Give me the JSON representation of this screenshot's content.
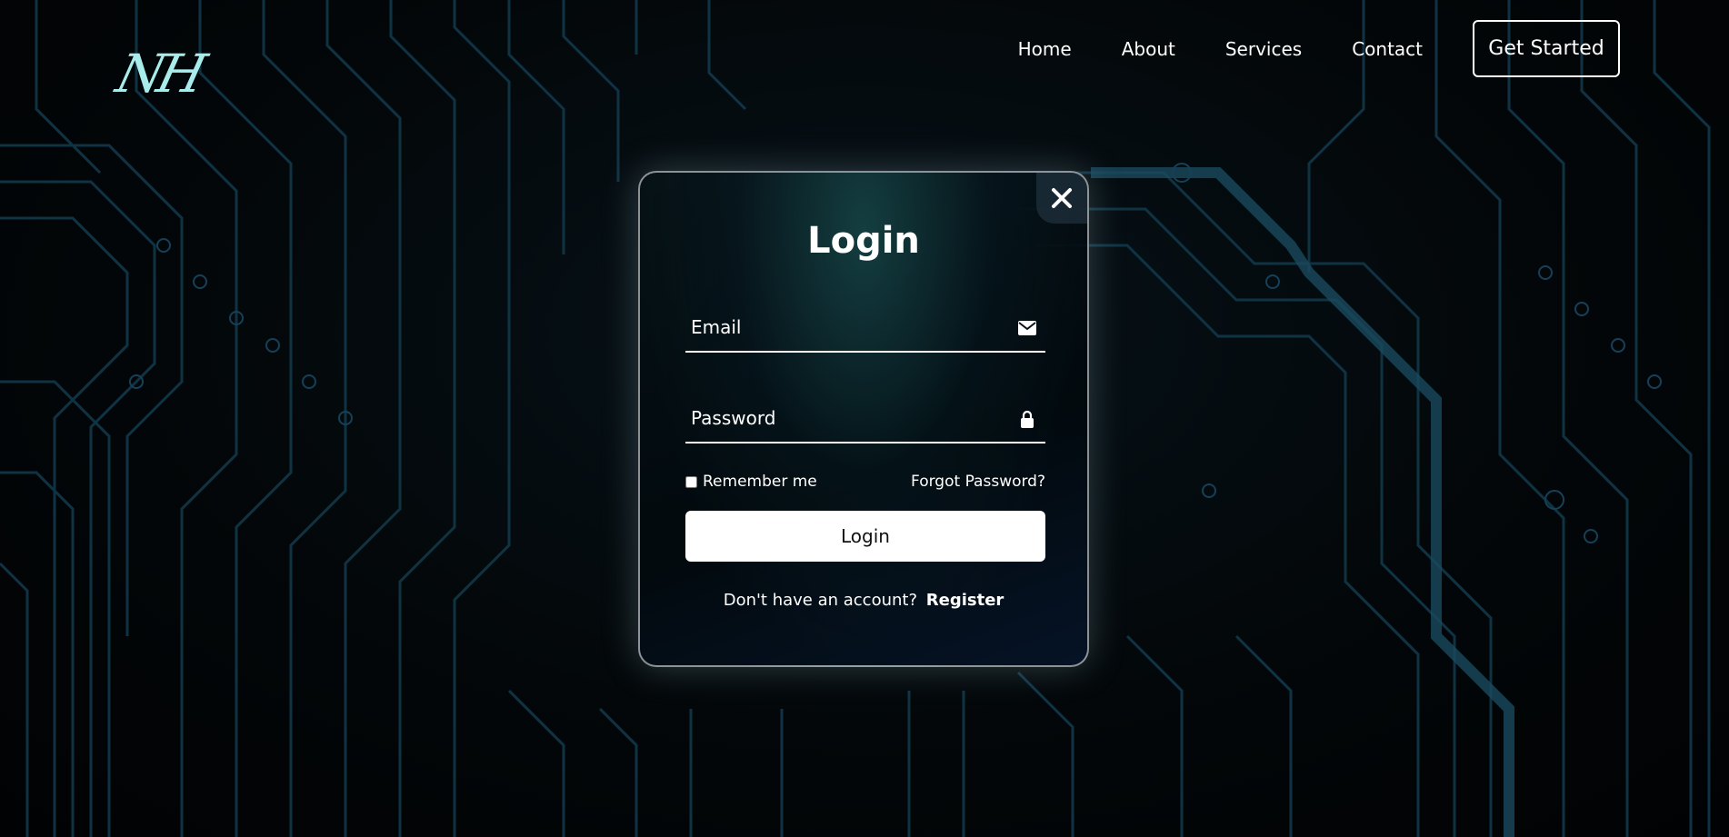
{
  "brand": {
    "logo_text": "NH"
  },
  "nav": {
    "links": [
      "Home",
      "About",
      "Services",
      "Contact"
    ],
    "cta_label": "Get Started"
  },
  "login_modal": {
    "title": "Login",
    "email_placeholder": "Email",
    "email_icon": "envelope-icon",
    "password_placeholder": "Password",
    "password_icon": "lock-icon",
    "remember_label": "Remember me",
    "remember_checked": false,
    "forgot_label": "Forgot Password?",
    "submit_label": "Login",
    "register_prompt": "Don't have an account?",
    "register_label": "Register",
    "close_icon": "close-icon"
  },
  "colors": {
    "background": "#020406",
    "logo": "#a9ecec",
    "circuit": "#12384a",
    "text": "#ffffff",
    "button_bg": "#ffffff"
  }
}
